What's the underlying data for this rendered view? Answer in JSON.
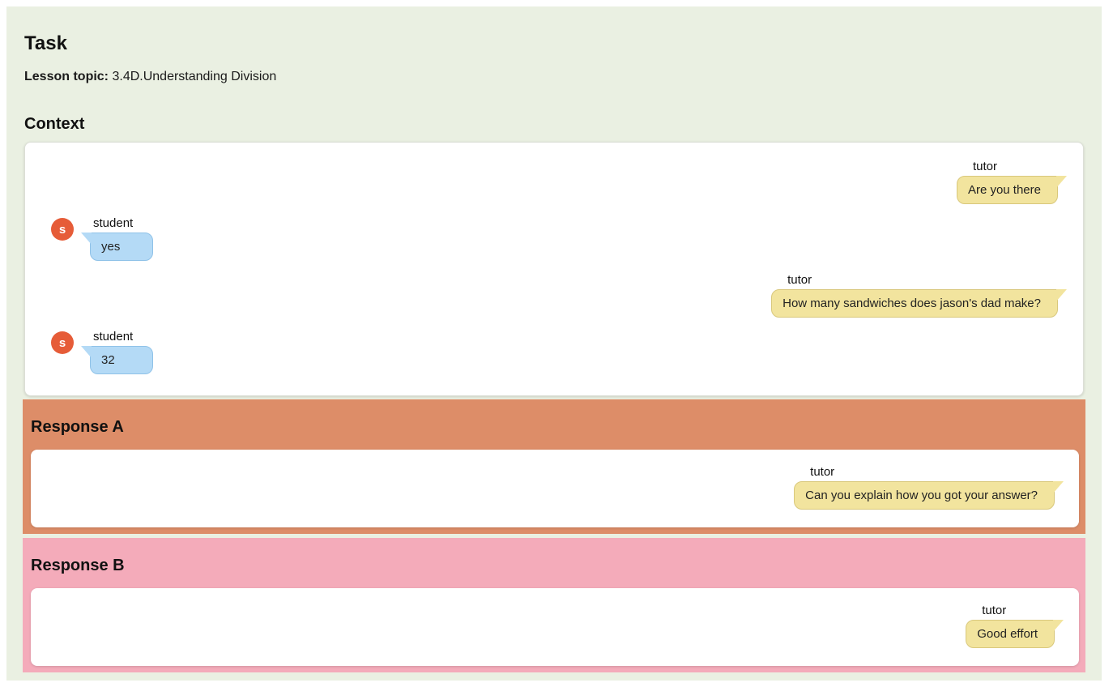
{
  "task": {
    "title": "Task",
    "lesson_topic_label": "Lesson topic:",
    "lesson_topic_value": "3.4D.Understanding Division"
  },
  "context": {
    "heading": "Context",
    "messages": [
      {
        "role": "tutor",
        "text": "Are you there"
      },
      {
        "role": "student",
        "avatar_letter": "s",
        "text": "yes"
      },
      {
        "role": "tutor",
        "text": "How many sandwiches does jason's dad make?"
      },
      {
        "role": "student",
        "avatar_letter": "s",
        "text": "32"
      }
    ]
  },
  "response_a": {
    "heading": "Response A",
    "messages": [
      {
        "role": "tutor",
        "text": "Can you explain how you got your answer?"
      }
    ]
  },
  "response_b": {
    "heading": "Response B",
    "messages": [
      {
        "role": "tutor",
        "text": "Good effort"
      }
    ]
  },
  "colors": {
    "page_bg": "#ffffff",
    "panel_bg": "#eaf0e2",
    "card_bg": "#ffffff",
    "tutor_bubble_bg": "#f2e49e",
    "tutor_bubble_border": "#d9c87c",
    "student_bubble_bg": "#b4daf6",
    "student_bubble_border": "#8fc2e8",
    "student_avatar_bg": "#e65c38",
    "response_a_bg": "#dd8d68",
    "response_b_bg": "#f4abba"
  }
}
